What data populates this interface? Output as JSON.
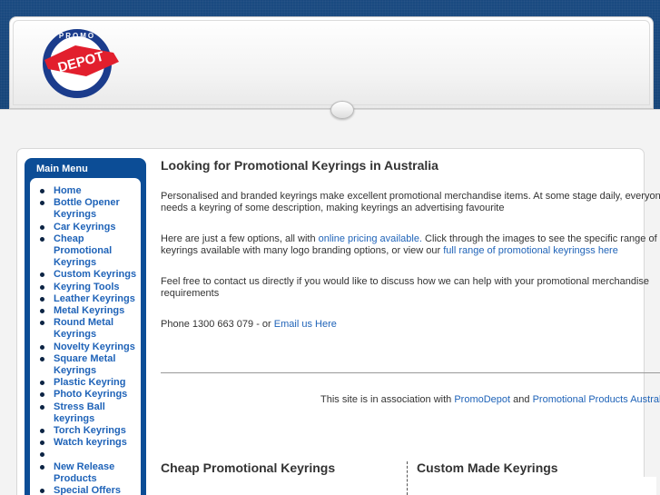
{
  "logo": {
    "top_text": "Promo",
    "main_text": "DEPOT",
    "colors": {
      "red": "#e21f2d",
      "blue": "#1b3c8c"
    }
  },
  "sidebar": {
    "title": "Main Menu",
    "items": [
      {
        "label": "Home"
      },
      {
        "label": "Bottle Opener Keyrings"
      },
      {
        "label": "Car Keyrings"
      },
      {
        "label": "Cheap Promotional Keyrings"
      },
      {
        "label": "Custom Keyrings"
      },
      {
        "label": "Keyring Tools"
      },
      {
        "label": "Leather Keyrings"
      },
      {
        "label": "Metal Keyrings"
      },
      {
        "label": "Round Metal Keyrings"
      },
      {
        "label": "Novelty Keyrings"
      },
      {
        "label": "Square Metal Keyrings"
      },
      {
        "label": "Plastic Keyring"
      },
      {
        "label": "Photo Keyrings"
      },
      {
        "label": "Stress Ball keyrings"
      },
      {
        "label": "Torch Keyrings"
      },
      {
        "label": "Watch keyrings"
      },
      {
        "label": ""
      },
      {
        "label": "New Release Products"
      },
      {
        "label": "Special Offers"
      },
      {
        "label": ""
      }
    ]
  },
  "content": {
    "title": "Looking for Promotional Keyrings in Australia",
    "p1_line1": "Personalised and branded keyrings make excellent promotional merchandise items. At some stage daily, everyone",
    "p1_line2": "needs a keyring of some description, making keyrings an advertising favourite",
    "p2_pre": "Here are just a few options, all with ",
    "p2_link1": "online pricing available.",
    "p2_mid": " Click through the images to see the specific range of",
    "p2_line2_pre": "keyrings available with many logo branding options, or view our ",
    "p2_link2": "full range of promotional keyringss here",
    "p3_line1": "Feel free to contact us directly if you would like to discuss how we can help with your promotional merchandise",
    "p3_line2": "requirements",
    "phone_text": "Phone 1300 663 079 - or ",
    "email_link": "Email us Here"
  },
  "footer": {
    "pre": "This site is in association with ",
    "link1": "PromoDepot",
    "and": " and ",
    "link2": "Promotional Products Australia"
  },
  "sections": {
    "left_title": "Cheap Promotional Keyrings",
    "right_title": "Custom Made Keyrings"
  }
}
